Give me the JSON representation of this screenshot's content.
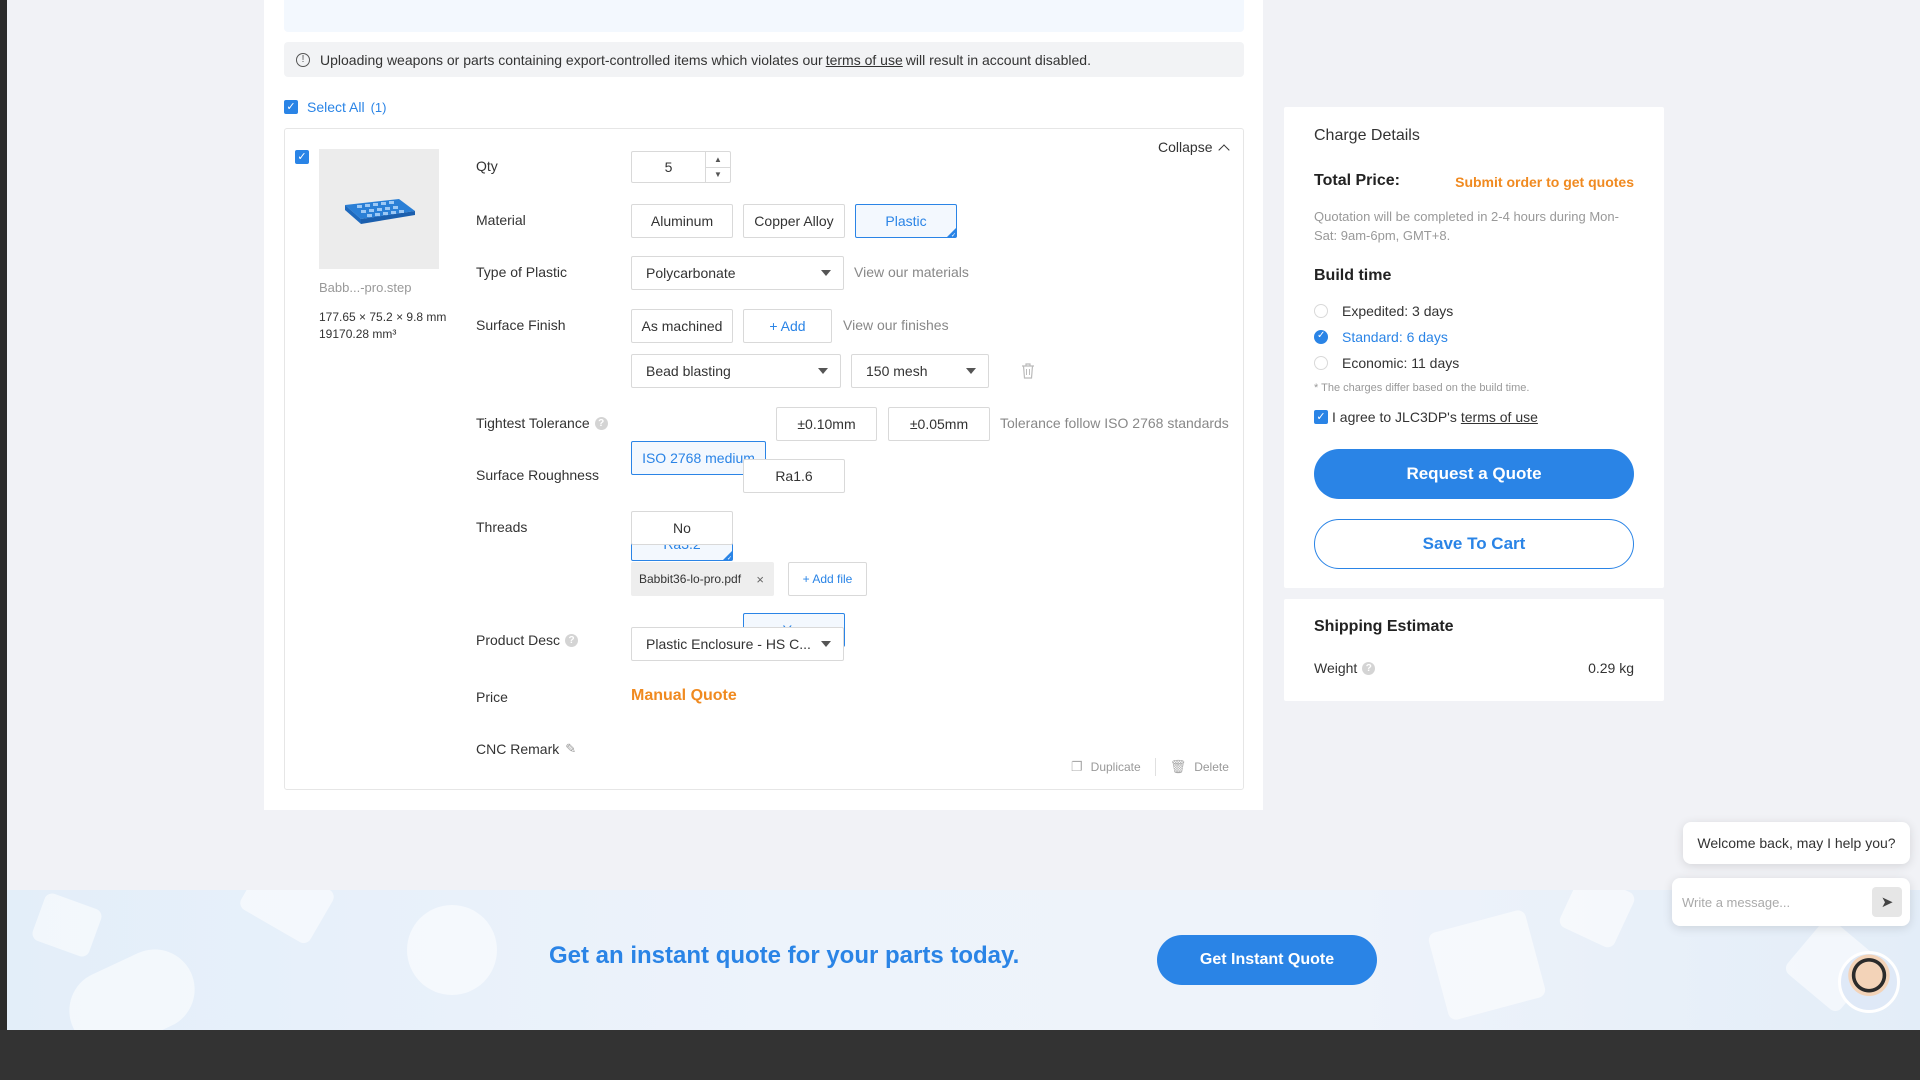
{
  "notice": {
    "text_before": "Uploading weapons or parts containing export-controlled items which violates our",
    "link": "terms of use",
    "text_after": "will result in account disabled."
  },
  "select_all": {
    "label": "Select All",
    "count": "(1)"
  },
  "item": {
    "file_name": "Babb...-pro.step",
    "dimensions": "177.65 × 75.2 × 9.8 mm",
    "volume": "19170.28 mm³",
    "collapse_label": "Collapse",
    "qty": {
      "label": "Qty",
      "value": "5"
    },
    "material": {
      "label": "Material",
      "options": [
        "Aluminum",
        "Copper Alloy",
        "Plastic"
      ],
      "selected": "Plastic"
    },
    "plastic_type": {
      "label": "Type of Plastic",
      "value": "Polycarbonate",
      "link": "View our materials"
    },
    "surface_finish": {
      "label": "Surface Finish",
      "value": "As machined",
      "add_label": "+ Add",
      "link": "View our finishes",
      "process": "Bead blasting",
      "mesh": "150 mesh"
    },
    "tolerance": {
      "label": "Tightest Tolerance",
      "options": [
        "ISO 2768 medium",
        "±0.10mm",
        "±0.05mm"
      ],
      "selected": "ISO 2768 medium",
      "note": "Tolerance follow ISO 2768 standards"
    },
    "roughness": {
      "label": "Surface Roughness",
      "options": [
        "Ra3.2",
        "Ra1.6"
      ],
      "selected": "Ra3.2"
    },
    "threads": {
      "label": "Threads",
      "options": [
        "No",
        "Yes"
      ],
      "selected": "Yes",
      "file": "Babbit36-lo-pro.pdf",
      "add_file": "+ Add file"
    },
    "product_desc": {
      "label": "Product Desc",
      "value": "Plastic Enclosure - HS C..."
    },
    "price": {
      "label": "Price",
      "value": "Manual Quote"
    },
    "cnc_remark": {
      "label": "CNC Remark"
    },
    "actions": {
      "duplicate": "Duplicate",
      "delete": "Delete"
    }
  },
  "charge": {
    "title": "Charge Details",
    "total_label": "Total Price:",
    "total_value": "Submit order to get quotes",
    "quote_note": "Quotation will be completed in 2-4 hours during Mon-Sat: 9am-6pm, GMT+8.",
    "build_title": "Build time",
    "build_options": [
      {
        "label": "Expedited: 3 days",
        "selected": false
      },
      {
        "label": "Standard: 6 days",
        "selected": true
      },
      {
        "label": "Economic: 11 days",
        "selected": false
      }
    ],
    "build_note": "* The charges differ based on the build time.",
    "agree_text": "I agree to JLC3DP's",
    "agree_link": "terms of use",
    "request_btn": "Request a Quote",
    "cart_btn": "Save To Cart"
  },
  "shipping": {
    "title": "Shipping Estimate",
    "weight_label": "Weight",
    "weight_value": "0.29 kg"
  },
  "banner": {
    "title": "Get an instant quote for your parts today.",
    "button": "Get Instant Quote"
  },
  "chat": {
    "greeting": "Welcome back, may I help you?",
    "placeholder": "Write a message..."
  },
  "colors": {
    "accent": "#2a84e6",
    "price_orange": "#f08a20",
    "footer": "#333333"
  }
}
